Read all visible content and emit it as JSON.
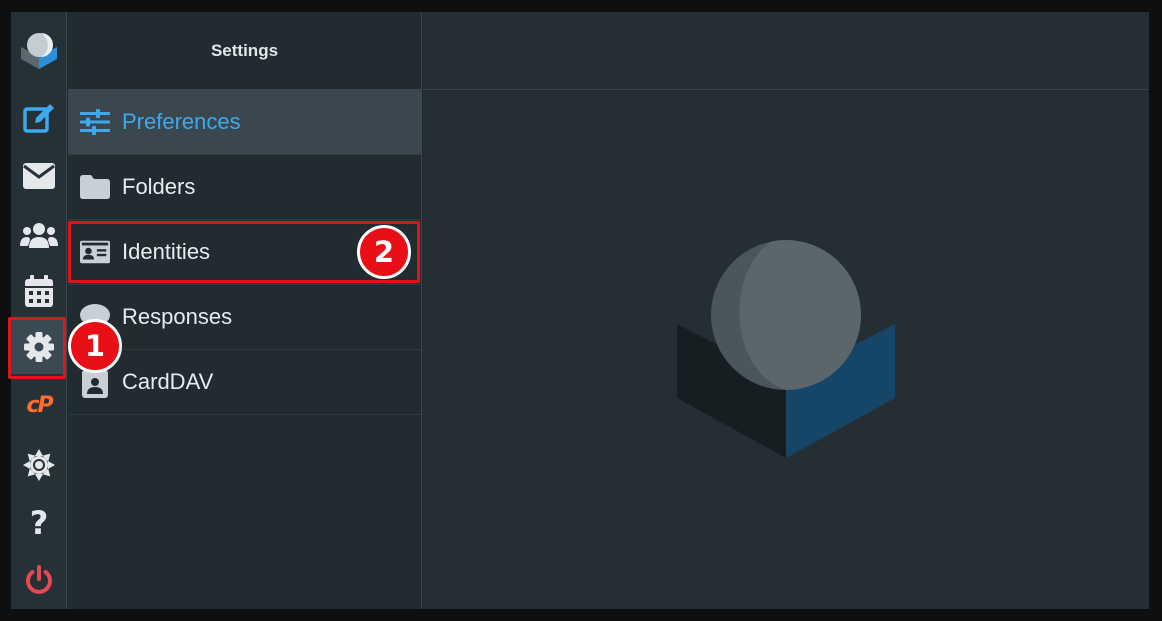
{
  "rail": {
    "items": [
      {
        "name": "logo",
        "icon": "roundcube-logo-icon"
      },
      {
        "name": "compose",
        "icon": "compose-icon"
      },
      {
        "name": "mail",
        "icon": "envelope-icon"
      },
      {
        "name": "contacts",
        "icon": "users-icon"
      },
      {
        "name": "calendar",
        "icon": "calendar-icon"
      },
      {
        "name": "settings",
        "icon": "gear-icon",
        "active": true
      },
      {
        "name": "cpanel",
        "icon": "cpanel-icon"
      },
      {
        "name": "theme",
        "icon": "sun-icon"
      },
      {
        "name": "help",
        "icon": "question-icon"
      },
      {
        "name": "logout",
        "icon": "power-icon"
      }
    ],
    "cpanel_label": "cP",
    "help_label": "?"
  },
  "settings": {
    "title": "Settings",
    "items": [
      {
        "label": "Preferences",
        "icon": "sliders-icon",
        "selected": true
      },
      {
        "label": "Folders",
        "icon": "folder-icon"
      },
      {
        "label": "Identities",
        "icon": "id-card-icon"
      },
      {
        "label": "Responses",
        "icon": "comment-icon"
      },
      {
        "label": "CardDAV",
        "icon": "badge-icon"
      }
    ]
  },
  "annotations": {
    "step1": "1",
    "step2": "2"
  },
  "colors": {
    "accent": "#3ea9ee",
    "highlight": "#e0141b",
    "cpanel": "#ff6c2c",
    "logout": "#e8484f"
  }
}
